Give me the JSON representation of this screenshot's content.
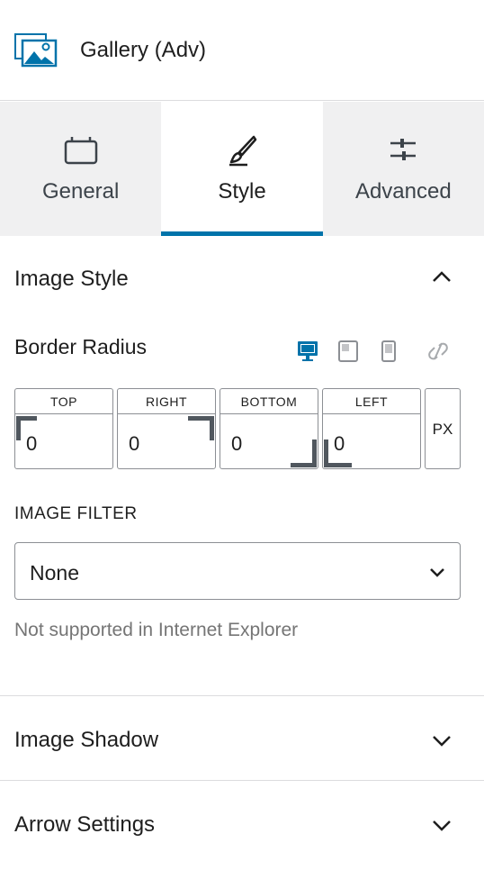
{
  "block": {
    "title": "Gallery (Adv)",
    "icon": "gallery-icon"
  },
  "tabs": [
    {
      "label": "General",
      "icon": "general-icon",
      "active": false
    },
    {
      "label": "Style",
      "icon": "brush-icon",
      "active": true
    },
    {
      "label": "Advanced",
      "icon": "sliders-icon",
      "active": false
    }
  ],
  "image_style": {
    "title": "Image Style",
    "border_radius": {
      "label": "Border Radius",
      "devices": [
        "desktop-icon",
        "tablet-icon",
        "mobile-icon"
      ],
      "link_icon": "unlink-icon",
      "fields": [
        {
          "caption": "TOP",
          "value": "0"
        },
        {
          "caption": "RIGHT",
          "value": "0"
        },
        {
          "caption": "BOTTOM",
          "value": "0"
        },
        {
          "caption": "LEFT",
          "value": "0"
        }
      ],
      "unit": "PX"
    },
    "filter": {
      "label": "IMAGE FILTER",
      "value": "None",
      "help": "Not supported in Internet Explorer"
    }
  },
  "panels": {
    "image_shadow": "Image Shadow",
    "arrow_settings": "Arrow Settings"
  },
  "colors": {
    "accent": "#0073aa",
    "border": "#8c8f94",
    "tab_bg": "#f0f0f1"
  }
}
